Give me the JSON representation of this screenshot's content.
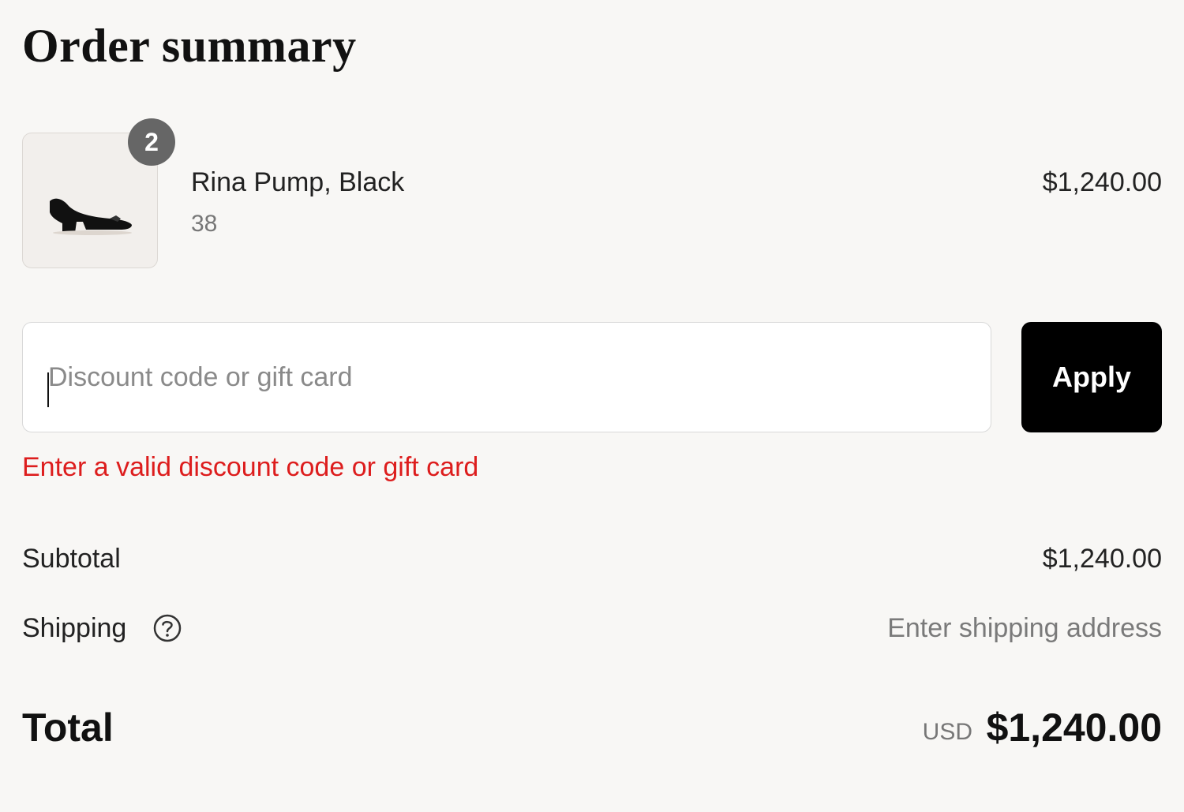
{
  "header": {
    "title": "Order summary"
  },
  "line_item": {
    "quantity": "2",
    "name": "Rina Pump, Black",
    "variant": "38",
    "price": "$1,240.00",
    "image_icon": "shoe-image"
  },
  "discount": {
    "placeholder": "Discount code or gift card",
    "value": "",
    "apply_label": "Apply",
    "error": "Enter a valid discount code or gift card"
  },
  "summary": {
    "subtotal_label": "Subtotal",
    "subtotal_value": "$1,240.00",
    "shipping_label": "Shipping",
    "shipping_help_icon": "help-circle-icon",
    "shipping_value": "Enter shipping address",
    "total_label": "Total",
    "total_currency": "USD",
    "total_value": "$1,240.00"
  },
  "colors": {
    "background": "#f8f7f5",
    "error": "#dd1d1d",
    "button": "#000000",
    "badge": "#666666"
  }
}
